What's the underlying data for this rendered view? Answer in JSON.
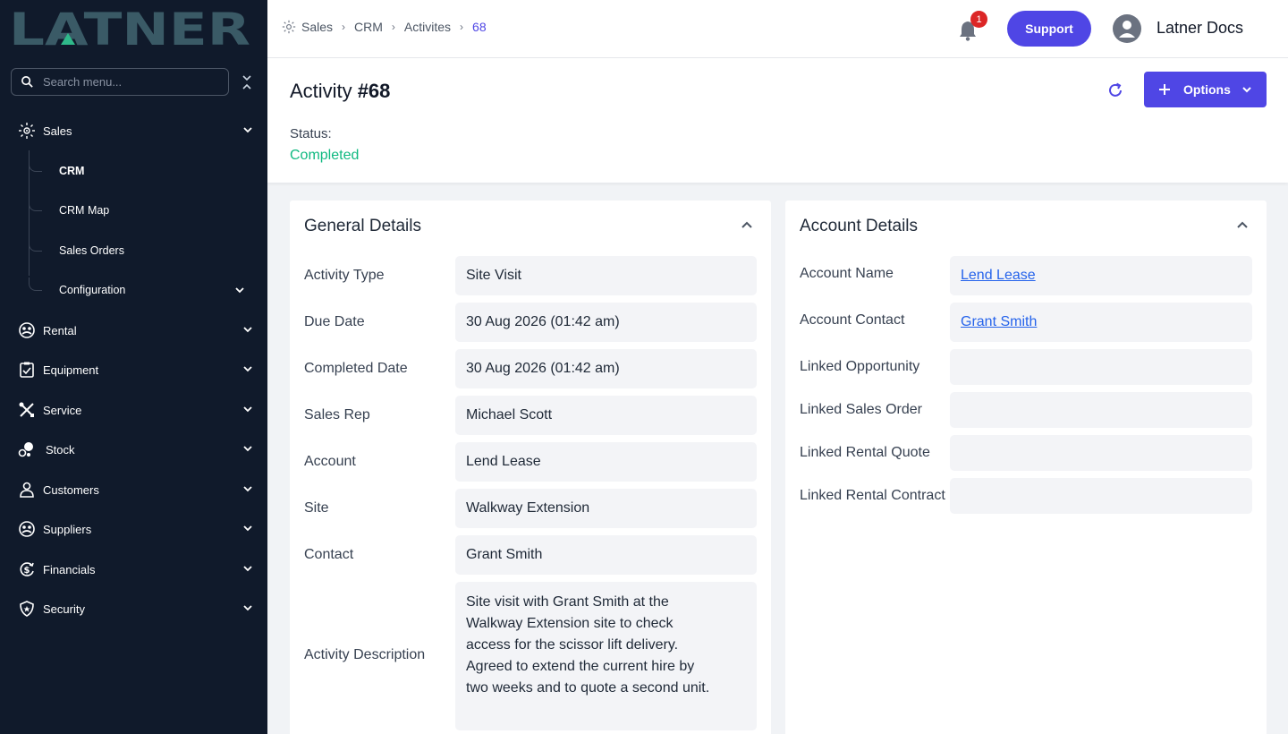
{
  "brand": {
    "logo_text": "LATNER"
  },
  "search": {
    "placeholder": "Search menu..."
  },
  "sidebar": {
    "items": [
      {
        "label": "Sales",
        "icon": "sales-icon"
      },
      {
        "label": "Rental",
        "icon": "rental-icon"
      },
      {
        "label": "Equipment",
        "icon": "equipment-icon"
      },
      {
        "label": "Service",
        "icon": "service-icon"
      },
      {
        "label": "Stock",
        "icon": "stock-icon"
      },
      {
        "label": "Customers",
        "icon": "customers-icon"
      },
      {
        "label": "Suppliers",
        "icon": "suppliers-icon"
      },
      {
        "label": "Financials",
        "icon": "financials-icon"
      },
      {
        "label": "Security",
        "icon": "security-icon"
      }
    ],
    "sales_sub": [
      {
        "label": "CRM",
        "active": true
      },
      {
        "label": "CRM Map"
      },
      {
        "label": "Sales Orders"
      },
      {
        "label": "Configuration"
      }
    ]
  },
  "breadcrumb": [
    "Sales",
    "CRM",
    "Activites",
    "68"
  ],
  "topbar": {
    "notification_count": "1",
    "support_label": "Support",
    "user_name": "Latner Docs"
  },
  "header": {
    "title": "Activity",
    "number": "#68",
    "options_label": "Options",
    "status_label": "Status:",
    "status_value": "Completed",
    "status_color": "#10b981"
  },
  "general": {
    "title": "General Details",
    "rows": [
      {
        "label": "Activity Type",
        "value": "Site Visit"
      },
      {
        "label": "Due Date",
        "value": "30 Aug 2026 (01:42 am)"
      },
      {
        "label": "Completed Date",
        "value": "30 Aug 2026 (01:42 am)"
      },
      {
        "label": "Sales Rep",
        "value": "Michael Scott"
      },
      {
        "label": "Account",
        "value": "Lend Lease"
      },
      {
        "label": "Site",
        "value": "Walkway Extension"
      },
      {
        "label": "Contact",
        "value": "Grant Smith"
      },
      {
        "label": "Activity Description",
        "value": "Site visit with Grant Smith at the Walkway Extension site to check access for the scissor lift delivery. Agreed to extend the current hire by two weeks and to quote a second unit."
      }
    ]
  },
  "account": {
    "title": "Account Details",
    "rows": [
      {
        "label": "Account Name",
        "value": "Lend Lease"
      },
      {
        "label": "Account Contact",
        "value": "Grant Smith"
      },
      {
        "label": "Linked Opportunity",
        "value": ""
      },
      {
        "label": "Linked Sales Order",
        "value": ""
      },
      {
        "label": "Linked Rental Quote",
        "value": ""
      },
      {
        "label": "Linked Rental Contract",
        "value": ""
      }
    ]
  },
  "colors": {
    "accent": "#4f46e5",
    "sidebar_bg": "#101a2b",
    "logo": "#3a5a66",
    "logo_mark": "#2fb98a"
  }
}
